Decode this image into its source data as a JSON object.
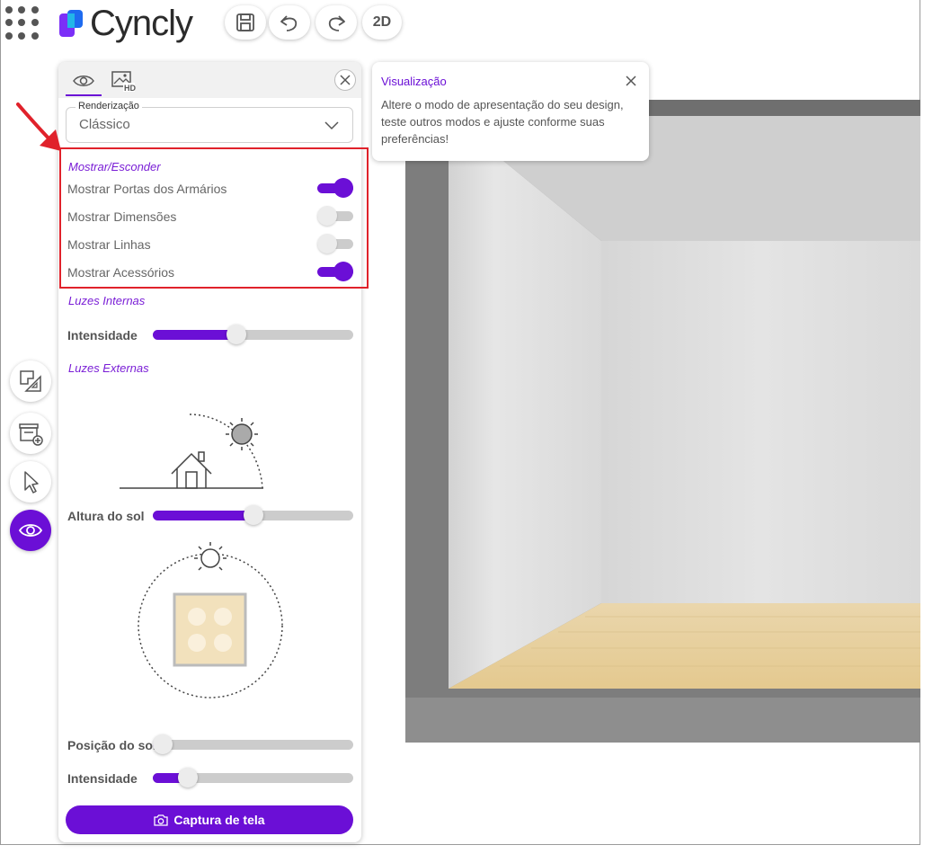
{
  "app": {
    "brand": "Cyncly",
    "brand_colors": [
      "#1e6bf0",
      "#7b2ff7",
      "#22b6e8"
    ]
  },
  "toolbar": {
    "view_2d_label": "2D"
  },
  "panel": {
    "tabs": [
      {
        "icon": "eye-icon"
      },
      {
        "icon": "hd-image-icon"
      }
    ],
    "render_select": {
      "label": "Renderização",
      "value": "Clássico"
    },
    "show_hide": {
      "title": "Mostrar/Esconder",
      "items": [
        {
          "label": "Mostrar Portas dos Armários",
          "on": true
        },
        {
          "label": "Mostrar Dimensões",
          "on": false
        },
        {
          "label": "Mostrar Linhas",
          "on": false
        },
        {
          "label": "Mostrar Acessórios",
          "on": true
        }
      ]
    },
    "internal_lights": {
      "title": "Luzes Internas",
      "intensity_label": "Intensidade",
      "intensity": 0.41
    },
    "external_lights": {
      "title": "Luzes Externas",
      "sun_height_label": "Altura do sol",
      "sun_height": 0.5,
      "sun_position_label": "Posição do sol",
      "sun_position": 0.0,
      "intensity_label": "Intensidade",
      "intensity": 0.14
    },
    "capture_button": "Captura de tela"
  },
  "tooltip": {
    "title": "Visualização",
    "body": "Altere o modo de apresentação do seu design, teste outros modos e ajuste conforme suas preferências!"
  },
  "colors": {
    "accent": "#6b0fd6",
    "annotation": "#e0222b"
  }
}
